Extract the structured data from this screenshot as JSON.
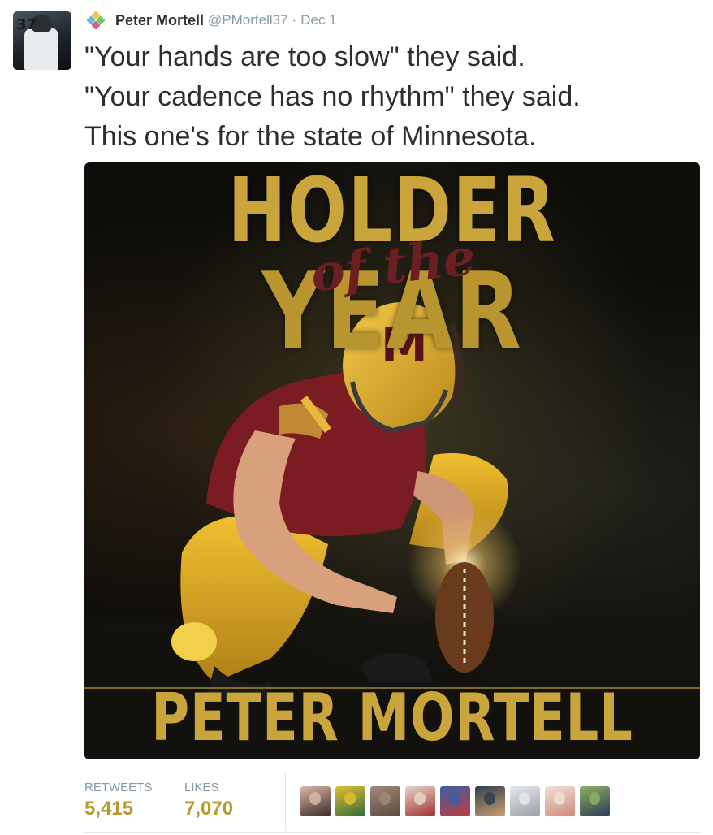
{
  "author": {
    "display_name": "Peter Mortell",
    "handle": "@PMortell37",
    "separator": "·",
    "date": "Dec 1",
    "avatar_icon": "profile-photo-jersey-37"
  },
  "tweet": {
    "lines": [
      "\"Your hands are too slow\" they said.",
      "\"Your cadence has no rhythm\" they said.",
      "This one's for the state of Minnesota."
    ]
  },
  "media": {
    "headline_top": "HOLDER",
    "headline_middle": "of the",
    "headline_bottom": "YEAR",
    "name": "PETER MORTELL",
    "colors": {
      "gold": "#c9a53c",
      "maroon": "#6b1f22"
    }
  },
  "stats": {
    "retweets_label": "RETWEETS",
    "retweets_value": "5,415",
    "likes_label": "LIKES",
    "likes_value": "7,070",
    "value_color": "#b69b2f"
  },
  "likers": [
    {
      "name": "liker-avatar-1",
      "colors": [
        "#3a2a24",
        "#d9b8a8"
      ]
    },
    {
      "name": "liker-avatar-2",
      "colors": [
        "#2f6b3e",
        "#e0c030"
      ]
    },
    {
      "name": "liker-avatar-3",
      "colors": [
        "#5a4a40",
        "#a08878"
      ]
    },
    {
      "name": "liker-avatar-4",
      "colors": [
        "#a33030",
        "#e4d6cc"
      ]
    },
    {
      "name": "liker-avatar-5",
      "colors": [
        "#c23b3b",
        "#3a5fa8"
      ]
    },
    {
      "name": "liker-avatar-6",
      "colors": [
        "#c9a070",
        "#30404a"
      ]
    },
    {
      "name": "liker-avatar-7",
      "colors": [
        "#9aa0a4",
        "#e6e8ea"
      ]
    },
    {
      "name": "liker-avatar-8",
      "colors": [
        "#d08a7a",
        "#f0e0d8"
      ]
    },
    {
      "name": "liker-avatar-9",
      "colors": [
        "#2a3a5a",
        "#8fb060"
      ]
    }
  ]
}
